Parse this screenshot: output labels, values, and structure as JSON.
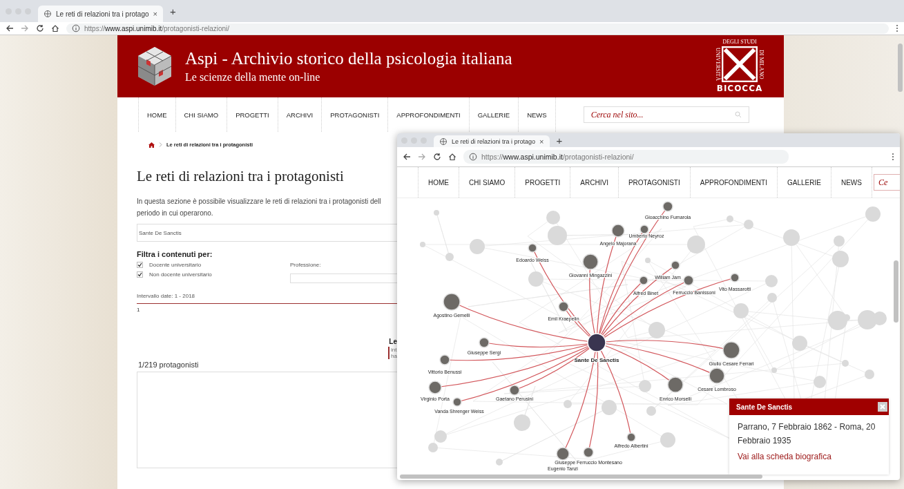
{
  "browser": {
    "tab_title": "Le reti di relazioni tra i protago",
    "tab_close": "×",
    "new_tab": "+",
    "url_scheme": "https://",
    "url_host": "www.aspi.unimib.it",
    "url_path": "/protagonisti-relazioni/"
  },
  "site_header": {
    "title": "Aspi - Archivio storico della psicologia italiana",
    "subtitle": "Le scienze della mente on-line",
    "university_logo": {
      "top": "DEGLI STUDI",
      "left": "UNIVERSITÀ",
      "right": "DI MILANO",
      "bottom": "BICOCCA"
    }
  },
  "nav": {
    "items": [
      "HOME",
      "CHI SIAMO",
      "PROGETTI",
      "ARCHIVI",
      "PROTAGONISTI",
      "APPROFONDIMENTI",
      "GALLERIE",
      "NEWS"
    ],
    "search_placeholder": "Cerca nel sito..."
  },
  "page": {
    "breadcrumb": "Le reti di relazioni tra i protagonisti",
    "title": "Le reti di relazioni tra i protagonisti",
    "intro_lines": [
      "In questa sezione è possibile visualizzare le reti di relazioni tra i protagonisti dell",
      "periodo in cui operarono."
    ],
    "search_value": "Sante De Sanctis",
    "filter_heading": "Filtra i contenuti per:",
    "filters": [
      {
        "label": "Docente universitario",
        "checked": true
      },
      {
        "label": "Non docente universitario",
        "checked": true
      }
    ],
    "profession_label": "Professione:",
    "date_range": "Intervallo date:  1 - 2018",
    "slider_value": "1",
    "legend_heading": "Le",
    "legend_lines": [
      "int",
      "ha"
    ],
    "count": "1/219 protagonisti"
  },
  "overlay_window": {
    "browser": {
      "tab_title": "Le reti di relazioni tra i protago",
      "tab_close": "×",
      "new_tab": "+",
      "url_scheme": "https://",
      "url_host": "www.aspi.unimib.it",
      "url_path": "/protagonisti-relazioni/"
    },
    "nav_items": [
      "HOME",
      "CHI SIAMO",
      "PROGETTI",
      "ARCHIVI",
      "PROTAGONISTI",
      "APPROFONDIMENTI",
      "GALLERIE",
      "NEWS"
    ],
    "search_fragment": "Ce",
    "graph_nodes": [
      {
        "name": "Gioacchino Fumarola",
        "kind": "related"
      },
      {
        "name": "Angelo Majorana",
        "kind": "related"
      },
      {
        "name": "Umberto Neyroz",
        "kind": "related"
      },
      {
        "name": "Edoardo Weiss",
        "kind": "related"
      },
      {
        "name": "Giovanni Mingazzini",
        "kind": "related"
      },
      {
        "name": "William Jam",
        "kind": "related"
      },
      {
        "name": "Alfred Binet",
        "kind": "related"
      },
      {
        "name": "Ferruccio Banissoni",
        "kind": "related"
      },
      {
        "name": "Vito Massarotti",
        "kind": "related"
      },
      {
        "name": "Agostino Gemelli",
        "kind": "related"
      },
      {
        "name": "Emil Kraepelin",
        "kind": "related"
      },
      {
        "name": "Sante De Sanctis",
        "kind": "focus"
      },
      {
        "name": "Giuseppe Sergi",
        "kind": "related"
      },
      {
        "name": "Giulio Cesare Ferrari",
        "kind": "related"
      },
      {
        "name": "Vittorio Benussi",
        "kind": "related"
      },
      {
        "name": "Cesare Lombroso",
        "kind": "related"
      },
      {
        "name": "Virginio Porta",
        "kind": "related"
      },
      {
        "name": "Gaetano Perusini",
        "kind": "related"
      },
      {
        "name": "Enrico Morselli",
        "kind": "related"
      },
      {
        "name": "Vanda Shrenger Weiss",
        "kind": "related"
      },
      {
        "name": "Alfredo Albertini",
        "kind": "related"
      },
      {
        "name": "Giuseppe Ferruccio Montesano",
        "kind": "related"
      },
      {
        "name": "Eugenio Tanzi",
        "kind": "related"
      }
    ],
    "popup": {
      "title": "Sante De Sanctis",
      "text": "Parrano, 7 Febbraio 1862 - Roma, 20 Febbraio 1935",
      "link": "Vai alla scheda biografica"
    }
  }
}
